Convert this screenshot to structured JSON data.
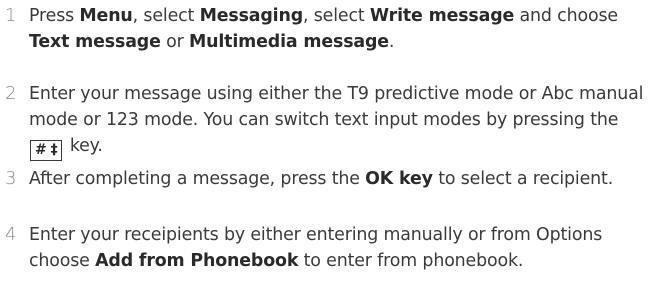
{
  "steps": [
    {
      "number": "1",
      "parts": [
        {
          "t": "Press "
        },
        {
          "t": "Menu",
          "b": true
        },
        {
          "t": ", select "
        },
        {
          "t": "Messaging",
          "b": true
        },
        {
          "t": ", select "
        },
        {
          "t": "Write message",
          "b": true
        },
        {
          "t": " and choose "
        },
        {
          "t": "Text message",
          "b": true
        },
        {
          "t": " or "
        },
        {
          "t": "Multimedia message",
          "b": true
        },
        {
          "t": "."
        }
      ]
    },
    {
      "number": "2",
      "parts": [
        {
          "t": "Enter your message using either the T9 predictive mode or Abc manual mode or 123 mode. You can switch text input modes by pressing the "
        },
        {
          "key": "#",
          "key2": "‡"
        },
        {
          "t": " key."
        }
      ]
    },
    {
      "number": "3",
      "parts": [
        {
          "t": "After completing a message, press the "
        },
        {
          "t": "OK key",
          "b": true
        },
        {
          "t": " to select a recipient."
        }
      ]
    },
    {
      "number": "4",
      "parts": [
        {
          "t": "Enter your receipients by either entering manually or from Options choose "
        },
        {
          "t": "Add from Phonebook",
          "b": true
        },
        {
          "t": " to enter from phonebook."
        }
      ]
    }
  ]
}
